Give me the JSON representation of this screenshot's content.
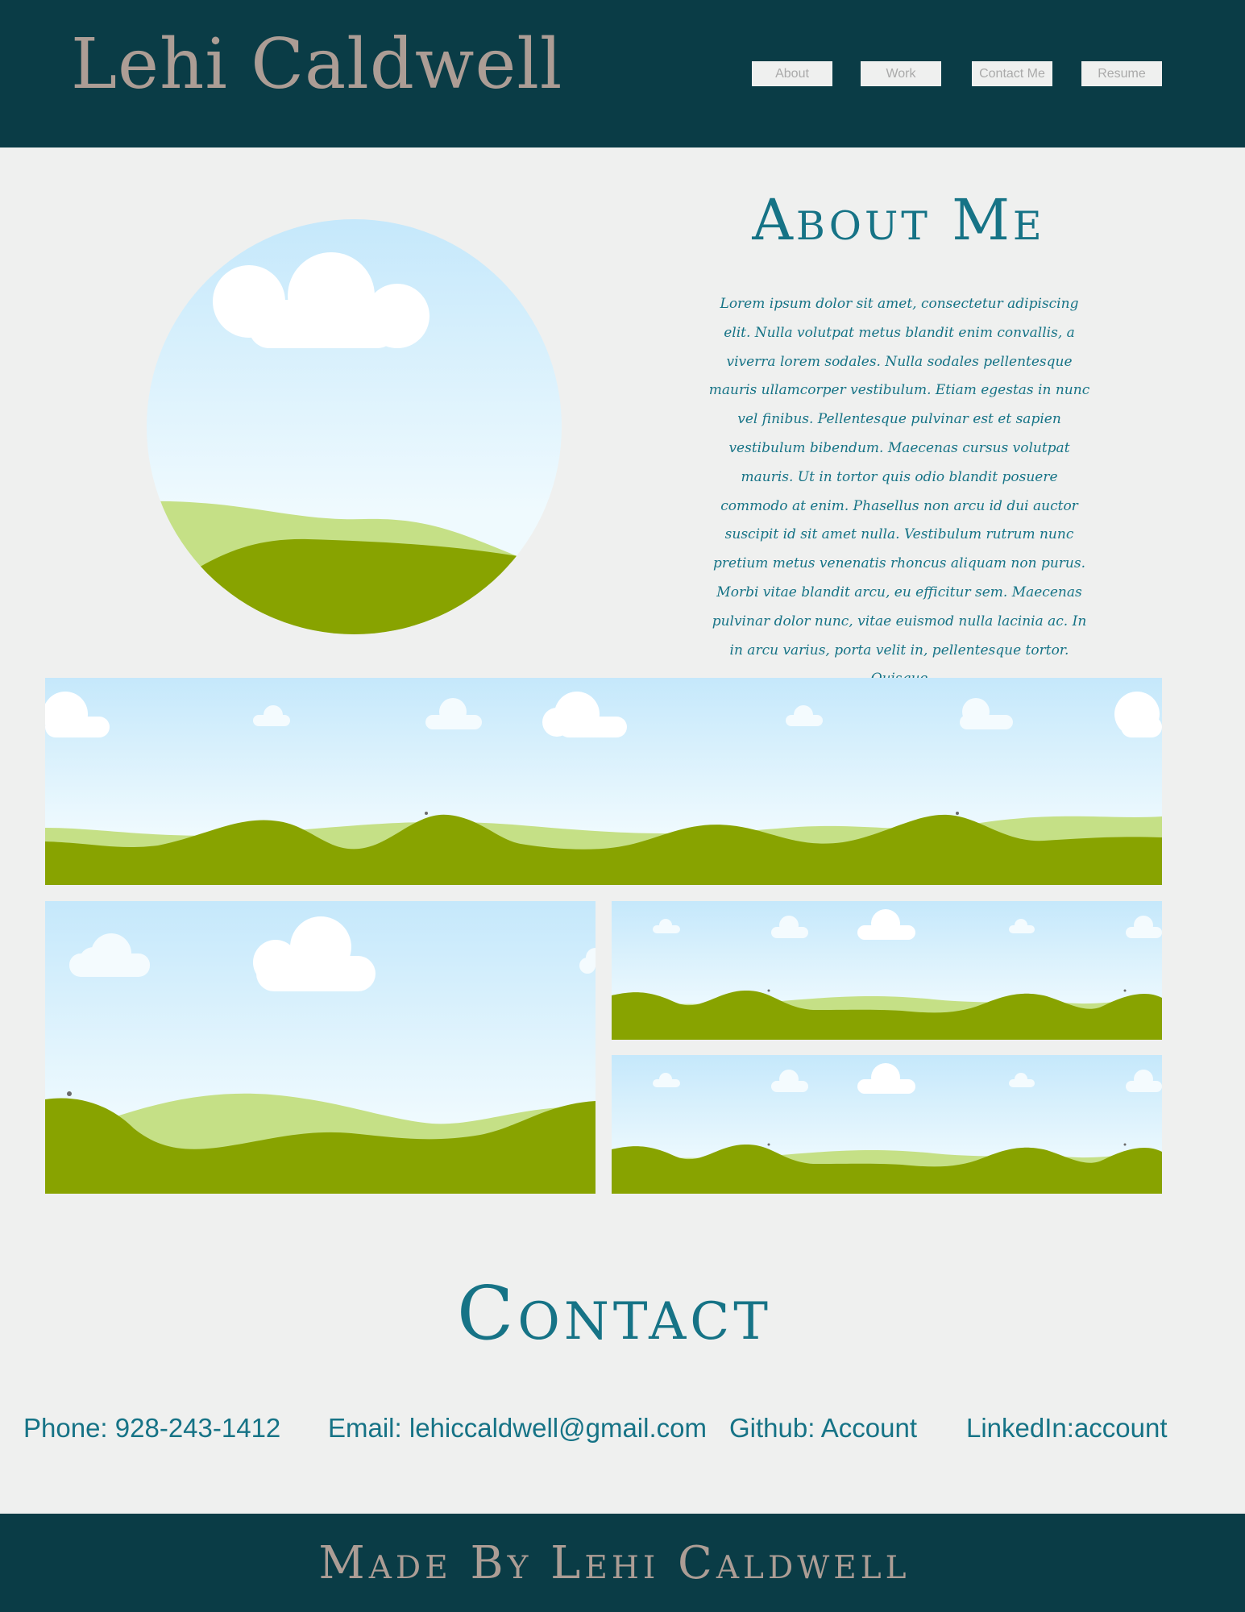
{
  "header": {
    "site_title": "Lehi Caldwell",
    "nav": [
      "About",
      "Work",
      "Contact Me",
      "Resume"
    ]
  },
  "about": {
    "title": "About Me",
    "body": "Lorem ipsum dolor sit amet, consectetur adipiscing elit. Nulla volutpat metus blandit enim convallis, a viverra lorem sodales. Nulla sodales pellentesque mauris ullamcorper vestibulum. Etiam egestas in nunc vel finibus. Pellentesque pulvinar est et sapien vestibulum bibendum. Maecenas cursus volutpat mauris. Ut in tortor quis odio blandit posuere commodo at enim. Phasellus non arcu id dui auctor suscipit id sit amet nulla. Vestibulum rutrum nunc pretium metus venenatis rhoncus aliquam non purus. Morbi vitae blandit arcu, eu efficitur sem. Maecenas pulvinar dolor nunc, vitae euismod nulla lacinia ac. In in arcu varius, porta velit in, pellentesque tortor. Quisque"
  },
  "contact": {
    "title": "Contact",
    "items": [
      {
        "label": "Phone:",
        "value": "928-243-1412"
      },
      {
        "label": "Email:",
        "value": "lehiccaldwell@gmail.com"
      },
      {
        "label": "Github:",
        "value": "Account"
      },
      {
        "label": "LinkedIn:",
        "value": "account"
      }
    ]
  },
  "footer": {
    "text": "Made By Lehi Caldwell"
  },
  "colors": {
    "header_bg": "#0a3c46",
    "accent_teal": "#167386",
    "taupe": "#ac9d95",
    "page_bg": "#eff0ef",
    "sky_top": "#c5e8fb",
    "sky_bottom": "#effafe",
    "hill_light": "#c5e086",
    "hill_dark": "#88a300"
  }
}
